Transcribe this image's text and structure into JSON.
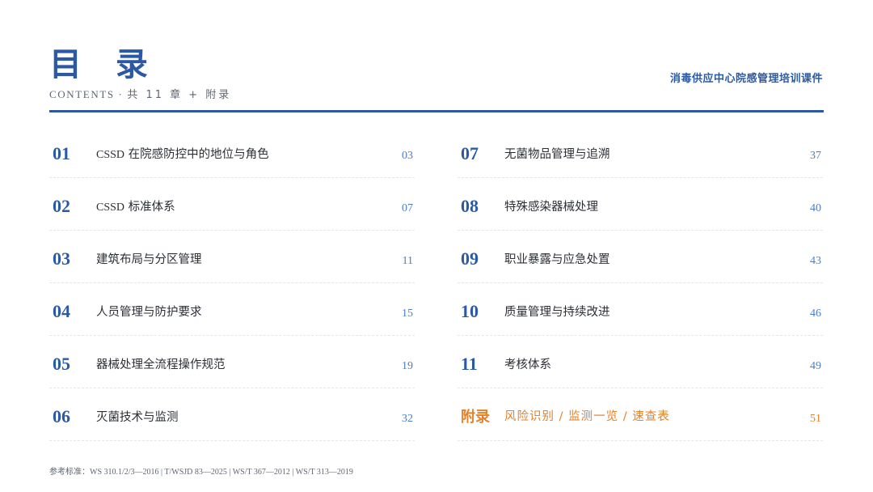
{
  "header": {
    "title": "目 录",
    "subtitle_latin": "CONTENTS · ",
    "subtitle_cn": "共 11 章 + 附录",
    "course_title": "消毒供应中心院感管理培训课件"
  },
  "toc_left": [
    {
      "num": "01",
      "prefix": "CSSD",
      "label": "在院感防控中的地位与角色",
      "page": "03"
    },
    {
      "num": "02",
      "prefix": "CSSD",
      "label": "标准体系",
      "page": "07"
    },
    {
      "num": "03",
      "prefix": "",
      "label": "建筑布局与分区管理",
      "page": "11"
    },
    {
      "num": "04",
      "prefix": "",
      "label": "人员管理与防护要求",
      "page": "15"
    },
    {
      "num": "05",
      "prefix": "",
      "label": "器械处理全流程操作规范",
      "page": "19"
    },
    {
      "num": "06",
      "prefix": "",
      "label": "灭菌技术与监测",
      "page": "32"
    }
  ],
  "toc_right": [
    {
      "num": "07",
      "label": "无菌物品管理与追溯",
      "page": "37"
    },
    {
      "num": "08",
      "label": "特殊感染器械处理",
      "page": "40"
    },
    {
      "num": "09",
      "label": "职业暴露与应急处置",
      "page": "43"
    },
    {
      "num": "10",
      "label": "质量管理与持续改进",
      "page": "46"
    },
    {
      "num": "11",
      "label": "考核体系",
      "page": "49"
    }
  ],
  "appendix": {
    "num": "附录",
    "label": "风险识别 / 监测一览 / 速查表",
    "page": "51"
  },
  "footer": {
    "label": "参考标准：",
    "text": "WS 310.1/2/3—2016 | T/WSJD 83—2025 | WS/T 367—2012 | WS/T 313—2019"
  },
  "colors": {
    "primary": "#2c59a4",
    "accent": "#e3822b",
    "page_number": "#4d7fc4"
  }
}
